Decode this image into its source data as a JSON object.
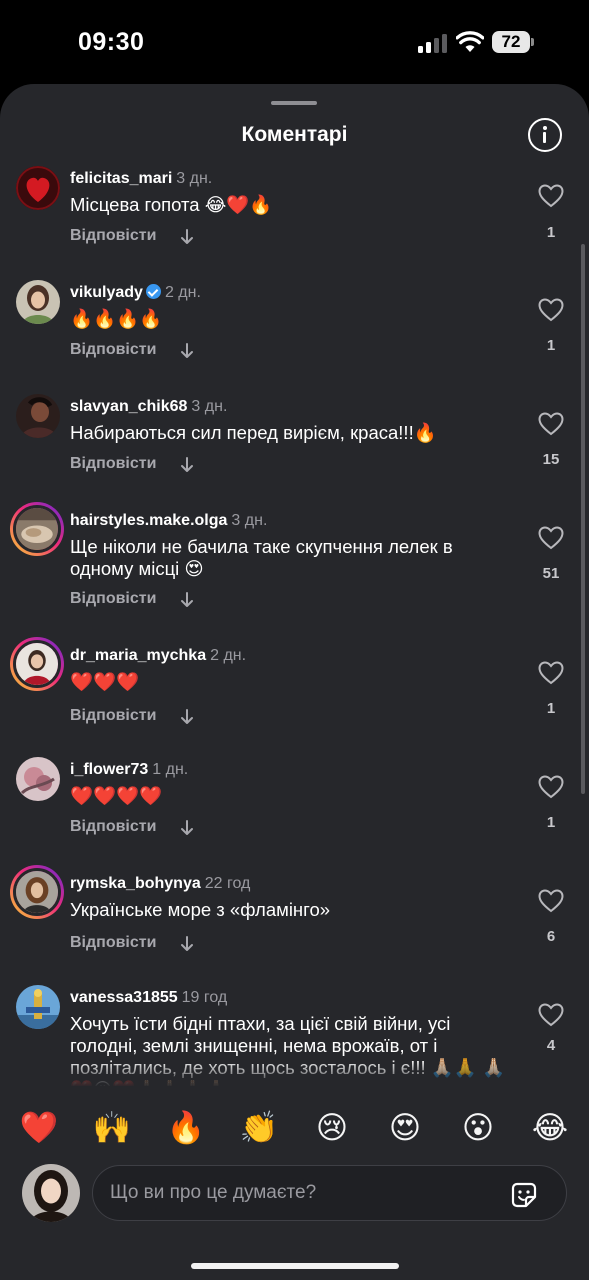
{
  "status_bar": {
    "time": "09:30",
    "battery": "72"
  },
  "sheet": {
    "title": "Коментарі"
  },
  "labels": {
    "reply": "Відповісти"
  },
  "comments": [
    {
      "username": "felicitas_mari",
      "time": "3 дн.",
      "text": "Місцева гопота 😂❤️🔥",
      "likes": "1",
      "verified": false
    },
    {
      "username": "vikulyady",
      "time": "2 дн.",
      "text": "🔥🔥🔥🔥",
      "likes": "1",
      "verified": true
    },
    {
      "username": "slavyan_chik68",
      "time": "3 дн.",
      "text": "Набираються сил перед вирієм, краса!!!🔥",
      "likes": "15",
      "verified": false
    },
    {
      "username": "hairstyles.make.olga",
      "time": "3 дн.",
      "text": "Ще ніколи не бачила таке скупчення лелек в одному місці 😍",
      "likes": "51",
      "verified": false
    },
    {
      "username": "dr_maria_mychka",
      "time": "2 дн.",
      "text": "❤️❤️❤️",
      "likes": "1",
      "verified": false
    },
    {
      "username": "i_flower73",
      "time": "1 дн.",
      "text": "❤️❤️❤️❤️",
      "likes": "1",
      "verified": false
    },
    {
      "username": "rymska_bohynya",
      "time": "22 год",
      "text": "Українське море з «фламінго»",
      "likes": "6",
      "verified": false
    },
    {
      "username": "vanessa31855",
      "time": "19 год",
      "text": "Хочуть їсти бідні птахи, за цієї свій війни, усі голодні, землі знищенні, нема  врожаїв, от і позлітались, де хоть щось зосталось і є!!! 🙏🏻🙏 🙏🏻❤️😥❤️🙏🏻🙏🏻🙏🏻🙏🏻",
      "likes": "4",
      "verified": false
    }
  ],
  "reactions": [
    "❤️",
    "🙌",
    "🔥",
    "👏",
    "😢",
    "😍",
    "😮",
    "😂"
  ],
  "composer": {
    "placeholder": "Що ви про це думаєте?"
  },
  "colors": {
    "background": "#26272b",
    "verified": "#3897f0",
    "story_ring": "#ee2a7b"
  }
}
